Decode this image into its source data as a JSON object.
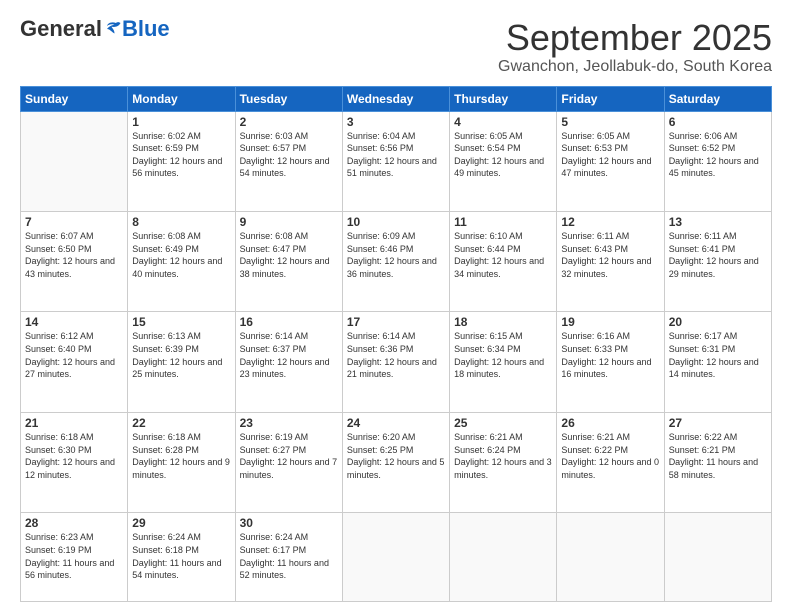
{
  "logo": {
    "general": "General",
    "blue": "Blue"
  },
  "header": {
    "month": "September 2025",
    "location": "Gwanchon, Jeollabuk-do, South Korea"
  },
  "weekdays": [
    "Sunday",
    "Monday",
    "Tuesday",
    "Wednesday",
    "Thursday",
    "Friday",
    "Saturday"
  ],
  "weeks": [
    [
      {
        "day": "",
        "info": ""
      },
      {
        "day": "1",
        "info": "Sunrise: 6:02 AM\nSunset: 6:59 PM\nDaylight: 12 hours\nand 56 minutes."
      },
      {
        "day": "2",
        "info": "Sunrise: 6:03 AM\nSunset: 6:57 PM\nDaylight: 12 hours\nand 54 minutes."
      },
      {
        "day": "3",
        "info": "Sunrise: 6:04 AM\nSunset: 6:56 PM\nDaylight: 12 hours\nand 51 minutes."
      },
      {
        "day": "4",
        "info": "Sunrise: 6:05 AM\nSunset: 6:54 PM\nDaylight: 12 hours\nand 49 minutes."
      },
      {
        "day": "5",
        "info": "Sunrise: 6:05 AM\nSunset: 6:53 PM\nDaylight: 12 hours\nand 47 minutes."
      },
      {
        "day": "6",
        "info": "Sunrise: 6:06 AM\nSunset: 6:52 PM\nDaylight: 12 hours\nand 45 minutes."
      }
    ],
    [
      {
        "day": "7",
        "info": "Sunrise: 6:07 AM\nSunset: 6:50 PM\nDaylight: 12 hours\nand 43 minutes."
      },
      {
        "day": "8",
        "info": "Sunrise: 6:08 AM\nSunset: 6:49 PM\nDaylight: 12 hours\nand 40 minutes."
      },
      {
        "day": "9",
        "info": "Sunrise: 6:08 AM\nSunset: 6:47 PM\nDaylight: 12 hours\nand 38 minutes."
      },
      {
        "day": "10",
        "info": "Sunrise: 6:09 AM\nSunset: 6:46 PM\nDaylight: 12 hours\nand 36 minutes."
      },
      {
        "day": "11",
        "info": "Sunrise: 6:10 AM\nSunset: 6:44 PM\nDaylight: 12 hours\nand 34 minutes."
      },
      {
        "day": "12",
        "info": "Sunrise: 6:11 AM\nSunset: 6:43 PM\nDaylight: 12 hours\nand 32 minutes."
      },
      {
        "day": "13",
        "info": "Sunrise: 6:11 AM\nSunset: 6:41 PM\nDaylight: 12 hours\nand 29 minutes."
      }
    ],
    [
      {
        "day": "14",
        "info": "Sunrise: 6:12 AM\nSunset: 6:40 PM\nDaylight: 12 hours\nand 27 minutes."
      },
      {
        "day": "15",
        "info": "Sunrise: 6:13 AM\nSunset: 6:39 PM\nDaylight: 12 hours\nand 25 minutes."
      },
      {
        "day": "16",
        "info": "Sunrise: 6:14 AM\nSunset: 6:37 PM\nDaylight: 12 hours\nand 23 minutes."
      },
      {
        "day": "17",
        "info": "Sunrise: 6:14 AM\nSunset: 6:36 PM\nDaylight: 12 hours\nand 21 minutes."
      },
      {
        "day": "18",
        "info": "Sunrise: 6:15 AM\nSunset: 6:34 PM\nDaylight: 12 hours\nand 18 minutes."
      },
      {
        "day": "19",
        "info": "Sunrise: 6:16 AM\nSunset: 6:33 PM\nDaylight: 12 hours\nand 16 minutes."
      },
      {
        "day": "20",
        "info": "Sunrise: 6:17 AM\nSunset: 6:31 PM\nDaylight: 12 hours\nand 14 minutes."
      }
    ],
    [
      {
        "day": "21",
        "info": "Sunrise: 6:18 AM\nSunset: 6:30 PM\nDaylight: 12 hours\nand 12 minutes."
      },
      {
        "day": "22",
        "info": "Sunrise: 6:18 AM\nSunset: 6:28 PM\nDaylight: 12 hours\nand 9 minutes."
      },
      {
        "day": "23",
        "info": "Sunrise: 6:19 AM\nSunset: 6:27 PM\nDaylight: 12 hours\nand 7 minutes."
      },
      {
        "day": "24",
        "info": "Sunrise: 6:20 AM\nSunset: 6:25 PM\nDaylight: 12 hours\nand 5 minutes."
      },
      {
        "day": "25",
        "info": "Sunrise: 6:21 AM\nSunset: 6:24 PM\nDaylight: 12 hours\nand 3 minutes."
      },
      {
        "day": "26",
        "info": "Sunrise: 6:21 AM\nSunset: 6:22 PM\nDaylight: 12 hours\nand 0 minutes."
      },
      {
        "day": "27",
        "info": "Sunrise: 6:22 AM\nSunset: 6:21 PM\nDaylight: 11 hours\nand 58 minutes."
      }
    ],
    [
      {
        "day": "28",
        "info": "Sunrise: 6:23 AM\nSunset: 6:19 PM\nDaylight: 11 hours\nand 56 minutes."
      },
      {
        "day": "29",
        "info": "Sunrise: 6:24 AM\nSunset: 6:18 PM\nDaylight: 11 hours\nand 54 minutes."
      },
      {
        "day": "30",
        "info": "Sunrise: 6:24 AM\nSunset: 6:17 PM\nDaylight: 11 hours\nand 52 minutes."
      },
      {
        "day": "",
        "info": ""
      },
      {
        "day": "",
        "info": ""
      },
      {
        "day": "",
        "info": ""
      },
      {
        "day": "",
        "info": ""
      }
    ]
  ]
}
